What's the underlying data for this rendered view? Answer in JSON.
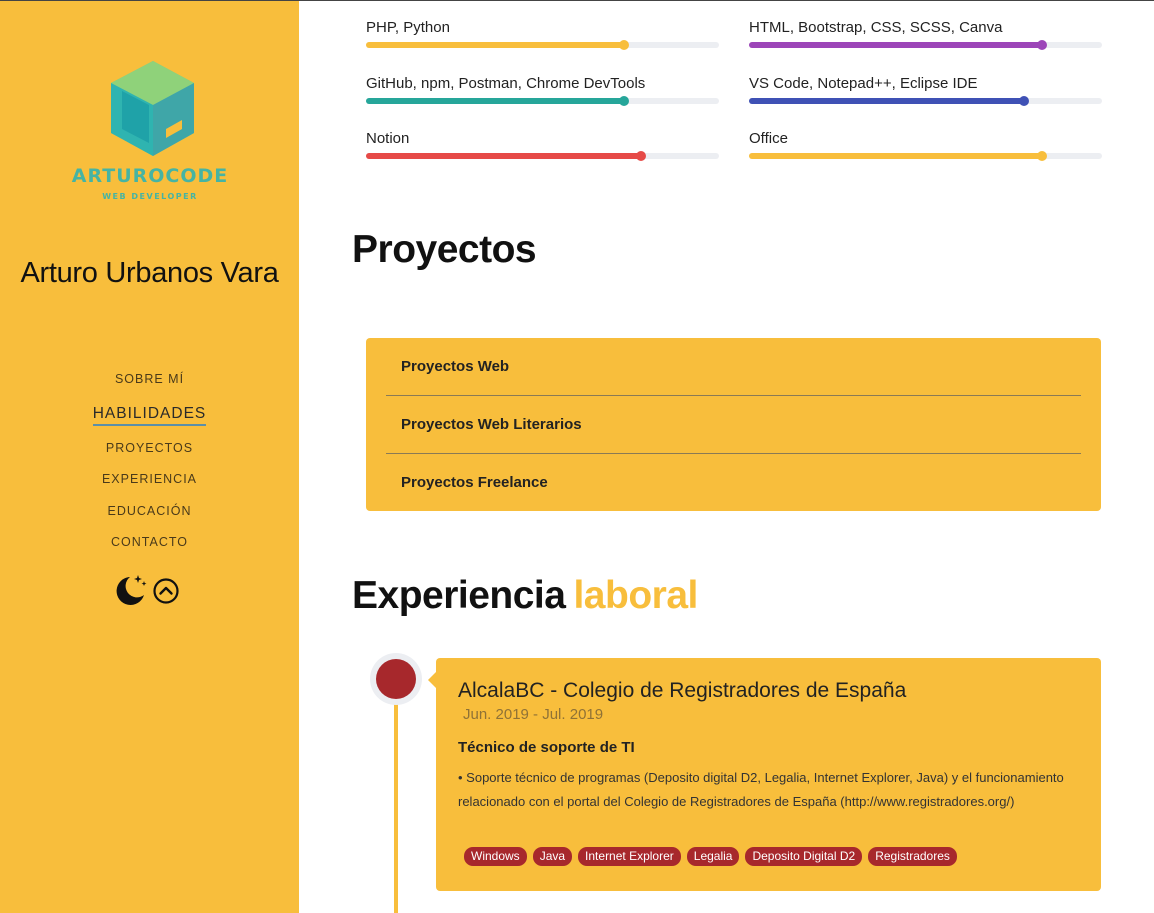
{
  "sidebar": {
    "logo": {
      "title": "ARTUROCODE",
      "subtitle": "WEB DEVELOPER"
    },
    "name": "Arturo Urbanos Vara",
    "nav": [
      {
        "label": "SOBRE MÍ",
        "active": false
      },
      {
        "label": "HABILIDADES",
        "active": true
      },
      {
        "label": "PROYECTOS",
        "active": false
      },
      {
        "label": "EXPERIENCIA",
        "active": false
      },
      {
        "label": "EDUCACIÓN",
        "active": false
      },
      {
        "label": "CONTACTO",
        "active": false
      }
    ],
    "icons": {
      "theme_toggle": "moon-stars-icon",
      "scroll_top": "arrow-up-circle-icon"
    }
  },
  "skills": [
    {
      "label": "PHP, Python",
      "percent": 73,
      "color": "#f8be3c"
    },
    {
      "label": "HTML, Bootstrap, CSS, SCSS, Canva",
      "percent": 83,
      "color": "#9c45b8"
    },
    {
      "label": "GitHub, npm, Postman, Chrome DevTools",
      "percent": 73,
      "color": "#26a69a"
    },
    {
      "label": "VS Code, Notepad++, Eclipse IDE",
      "percent": 78,
      "color": "#3f51b5"
    },
    {
      "label": "Notion",
      "percent": 78,
      "color": "#e64a47"
    },
    {
      "label": "Office",
      "percent": 83,
      "color": "#f8be3c"
    }
  ],
  "projects": {
    "heading": "Proyectos",
    "items": [
      "Proyectos Web",
      "Proyectos Web Literarios",
      "Proyectos Freelance"
    ]
  },
  "experience": {
    "heading": "Experiencia",
    "heading_accent": "laboral",
    "entries": [
      {
        "company": "AlcalaBC - Colegio de Registradores de España",
        "date": "Jun. 2019 - Jul. 2019",
        "role": "Técnico de soporte de TI",
        "description": "• Soporte técnico de programas (Deposito digital D2, Legalia, Internet Explorer, Java) y el funcionamiento relacionado con el portal del Colegio de Registradores de España (http://www.registradores.org/)",
        "tags": [
          "Windows",
          "Java",
          "Internet Explorer",
          "Legalia",
          "Deposito Digital D2",
          "Registradores"
        ]
      }
    ]
  },
  "colors": {
    "accent": "#f8be3c",
    "timeline_dot": "#a7282c",
    "logo": "#46b4a3"
  }
}
